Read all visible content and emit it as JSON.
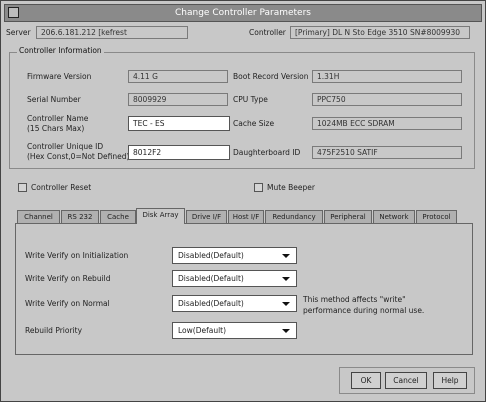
{
  "window": {
    "title": "Change Controller Parameters"
  },
  "header": {
    "server_label": "Server",
    "server_value": "206.6.181.212 [kefrest",
    "controller_label": "Controller",
    "controller_value": "[Primary] DL N Sto Edge 3510 SN#8009930"
  },
  "controller_info": {
    "legend": "Controller Information",
    "firmware_label": "Firmware Version",
    "firmware_value": "4.11 G",
    "bootrecord_label": "Boot Record Version",
    "bootrecord_value": "1.31H",
    "serial_label": "Serial Number",
    "serial_value": "8009929",
    "cpu_label": "CPU Type",
    "cpu_value": "PPC750",
    "name_label_1": "Controller Name",
    "name_label_2": "(15 Chars Max)",
    "name_value": "TEC - ES",
    "cache_label": "Cache Size",
    "cache_value": "1024MB ECC SDRAM",
    "unique_label_1": "Controller Unique ID",
    "unique_label_2": "(Hex Const,0=Not Defined)",
    "unique_value": "8012F2",
    "daughterboard_label": "Daughterboard ID",
    "daughterboard_value": "475F2510 SATIF"
  },
  "options": {
    "reset_label": "Controller Reset",
    "mute_label": "Mute Beeper"
  },
  "tabs": [
    {
      "label": "Channel"
    },
    {
      "label": "RS 232"
    },
    {
      "label": "Cache"
    },
    {
      "label": "Disk Array"
    },
    {
      "label": "Drive I/F"
    },
    {
      "label": "Host I/F"
    },
    {
      "label": "Redundancy"
    },
    {
      "label": "Peripheral"
    },
    {
      "label": "Network"
    },
    {
      "label": "Protocol"
    }
  ],
  "active_tab": "Disk Array",
  "disk_array": {
    "write_verify_init_label": "Write Verify on Initialization",
    "write_verify_init_value": "Disabled(Default)",
    "write_verify_rebuild_label": "Write Verify on Rebuild",
    "write_verify_rebuild_value": "Disabled(Default)",
    "write_verify_normal_label": "Write Verify on Normal",
    "write_verify_normal_value": "Disabled(Default)",
    "normal_note_1": "This method affects \"write\"",
    "normal_note_2": "performance during normal use.",
    "rebuild_priority_label": "Rebuild Priority",
    "rebuild_priority_value": "Low(Default)"
  },
  "buttons": {
    "ok": "OK",
    "cancel": "Cancel",
    "help": "Help"
  }
}
